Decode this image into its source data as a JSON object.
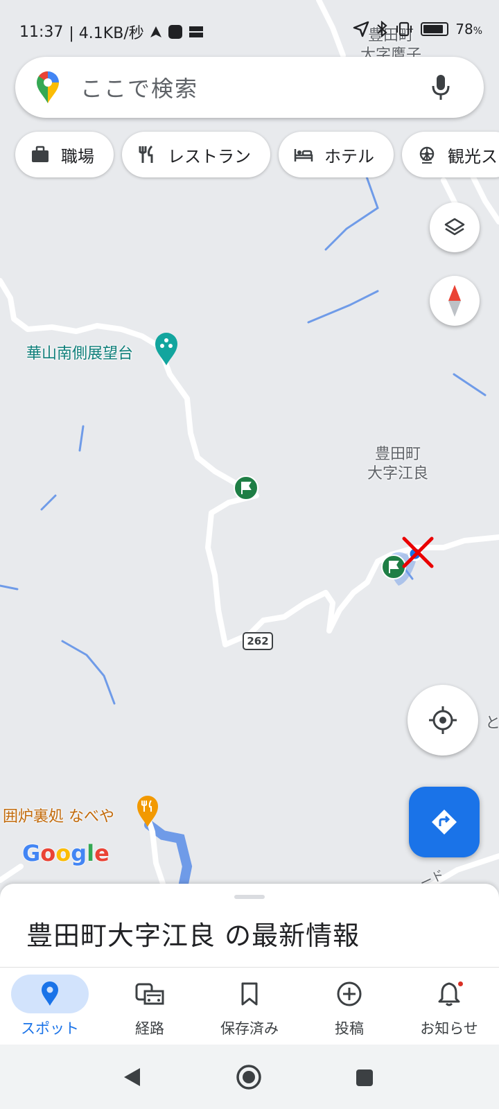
{
  "status_bar": {
    "time": "11:37",
    "network_speed": "| 4.1KB/秒",
    "battery_percent": "78"
  },
  "search": {
    "placeholder": "ここで検索"
  },
  "chips": [
    {
      "label": "職場",
      "icon": "briefcase-icon"
    },
    {
      "label": "レストラン",
      "icon": "restaurant-icon"
    },
    {
      "label": "ホテル",
      "icon": "hotel-icon"
    },
    {
      "label": "観光ス",
      "icon": "attraction-icon"
    }
  ],
  "map": {
    "labels": {
      "area_top": "豊田町\n大字鷹子",
      "area_top_line1": "豊田町",
      "area_top_line2": "大字鷹子",
      "area_center_line1": "豊田町",
      "area_center_line2": "大字江良",
      "viewpoint": "華山南側展望台",
      "restaurant": "囲炉裏処 なべや",
      "route_number": "262",
      "road_fragment": "ード",
      "edge_fragment": "と"
    },
    "logo_letters": [
      "G",
      "o",
      "o",
      "g",
      "l",
      "e"
    ],
    "colors": {
      "background": "#e8eaed",
      "road": "#ffffff",
      "water": "#6f9be8",
      "poi_teal": "#12a59e",
      "poi_orange": "#f29900",
      "park_green": "#1e7e45",
      "marker_red": "#ea0000"
    }
  },
  "bottom_sheet": {
    "title": "豊田町大字江良 の最新情報"
  },
  "bottom_nav": {
    "items": [
      {
        "label": "スポット",
        "icon": "place-pin-icon",
        "active": true
      },
      {
        "label": "経路",
        "icon": "commute-icon",
        "active": false
      },
      {
        "label": "保存済み",
        "icon": "bookmark-icon",
        "active": false
      },
      {
        "label": "投稿",
        "icon": "add-circle-icon",
        "active": false
      },
      {
        "label": "お知らせ",
        "icon": "bell-icon",
        "active": false
      }
    ]
  }
}
